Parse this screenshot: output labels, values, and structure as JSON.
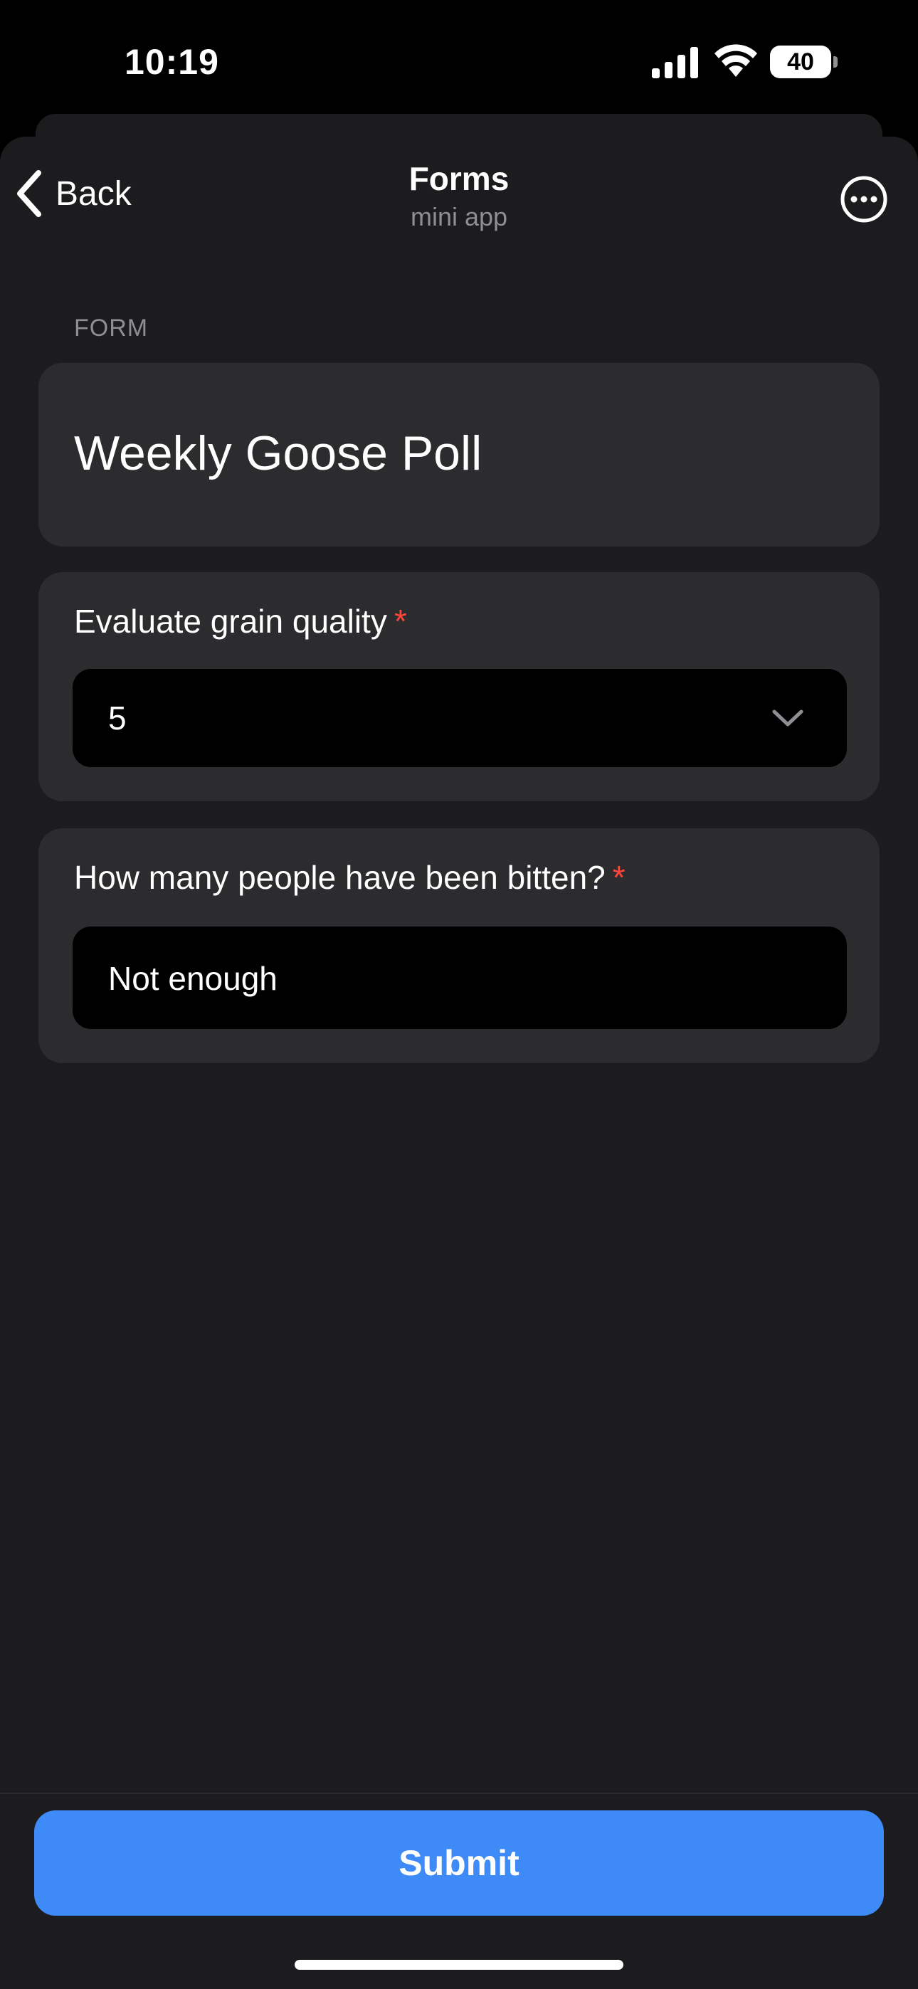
{
  "status_bar": {
    "time": "10:19",
    "battery_level": "40",
    "icons": [
      "signal-icon",
      "wifi-icon",
      "battery-icon"
    ]
  },
  "nav": {
    "back_label": "Back",
    "title": "Forms",
    "subtitle": "mini app",
    "icons": [
      "chevron-left-icon",
      "more-options-icon"
    ]
  },
  "form": {
    "section_label": "FORM",
    "title": "Weekly Goose Poll",
    "questions": [
      {
        "label": "Evaluate grain quality",
        "required_mark": "*",
        "type": "select",
        "value": "5"
      },
      {
        "label": "How many people have been bitten?",
        "required_mark": "*",
        "type": "text",
        "value": "Not enough"
      }
    ]
  },
  "footer": {
    "submit_label": "Submit"
  },
  "colors": {
    "background": "#1c1c1e",
    "card": "#2c2c2e",
    "field": "#000000",
    "accent": "#3e8af7",
    "required": "#ff453a",
    "muted_text": "#8e8e93"
  }
}
